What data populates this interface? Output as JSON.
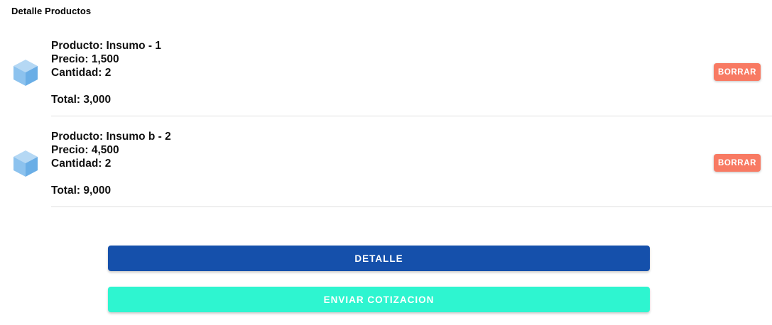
{
  "section": {
    "title": "Detalle Productos"
  },
  "products": [
    {
      "icon": "cube-icon",
      "product_line": "Producto: Insumo - 1",
      "price_line": "Precio: 1,500",
      "quantity_line": "Cantidad: 2",
      "total_line": "Total: 3,000",
      "delete_label": "BORRAR"
    },
    {
      "icon": "cube-icon",
      "product_line": "Producto: Insumo b - 2",
      "price_line": "Precio: 4,500",
      "quantity_line": "Cantidad: 2",
      "total_line": "Total: 9,000",
      "delete_label": "BORRAR"
    }
  ],
  "actions": {
    "detail_label": "DETALLE",
    "send_quote_label": "ENVIAR COTIZACION"
  },
  "colors": {
    "delete_button": "#f87a63",
    "detail_button": "#1550ab",
    "send_quote_button": "#2ef5d0",
    "cube_light": "#b5d8f4",
    "cube_left": "#8cc2ee",
    "cube_right": "#6aaee6"
  }
}
